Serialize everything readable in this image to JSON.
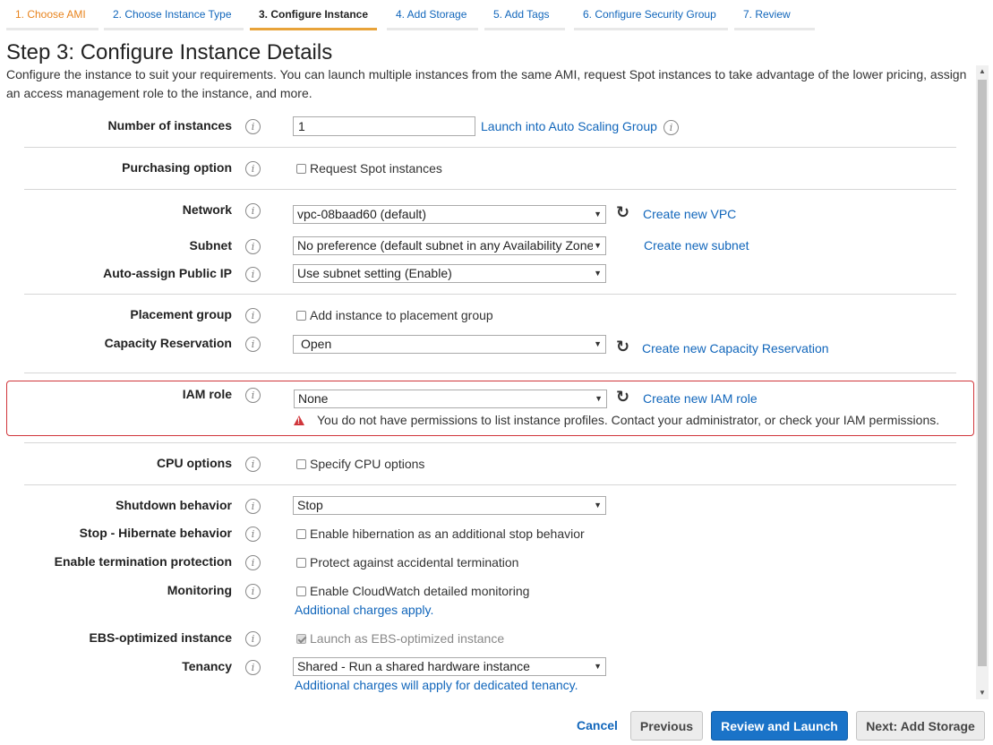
{
  "tabs": [
    {
      "label": "1. Choose AMI",
      "state": "done"
    },
    {
      "label": "2. Choose Instance Type",
      "state": "link"
    },
    {
      "label": "3. Configure Instance",
      "state": "active"
    },
    {
      "label": "4. Add Storage",
      "state": "link"
    },
    {
      "label": "5. Add Tags",
      "state": "link"
    },
    {
      "label": "6. Configure Security Group",
      "state": "link"
    },
    {
      "label": "7. Review",
      "state": "link"
    }
  ],
  "page": {
    "title": "Step 3: Configure Instance Details",
    "description": "Configure the instance to suit your requirements. You can launch multiple instances from the same AMI, request Spot instances to take advantage of the lower pricing, assign an access management role to the instance, and more."
  },
  "fields": {
    "instances": {
      "label": "Number of instances",
      "value": "1",
      "link": "Launch into Auto Scaling Group"
    },
    "purchasing": {
      "label": "Purchasing option",
      "checkbox": "Request Spot instances",
      "checked": false
    },
    "network": {
      "label": "Network",
      "value": "vpc-08baad60 (default)",
      "link": "Create new VPC"
    },
    "subnet": {
      "label": "Subnet",
      "value": "No preference (default subnet in any Availability Zone)",
      "link": "Create new subnet"
    },
    "public_ip": {
      "label": "Auto-assign Public IP",
      "value": "Use subnet setting (Enable)"
    },
    "placement": {
      "label": "Placement group",
      "checkbox": "Add instance to placement group",
      "checked": false
    },
    "capacity": {
      "label": "Capacity Reservation",
      "value": "Open",
      "link": "Create new Capacity Reservation"
    },
    "iam": {
      "label": "IAM role",
      "value": "None",
      "link": "Create new IAM role",
      "warning": "You do not have permissions to list instance profiles. Contact your administrator, or check your IAM permissions."
    },
    "cpu": {
      "label": "CPU options",
      "checkbox": "Specify CPU options",
      "checked": false
    },
    "shutdown": {
      "label": "Shutdown behavior",
      "value": "Stop"
    },
    "hibernate": {
      "label": "Stop - Hibernate behavior",
      "checkbox": "Enable hibernation as an additional stop behavior",
      "checked": false
    },
    "termination": {
      "label": "Enable termination protection",
      "checkbox": "Protect against accidental termination",
      "checked": false
    },
    "monitoring": {
      "label": "Monitoring",
      "checkbox": "Enable CloudWatch detailed monitoring",
      "checked": false,
      "note": "Additional charges apply."
    },
    "ebs": {
      "label": "EBS-optimized instance",
      "checkbox": "Launch as EBS-optimized instance",
      "checked": true,
      "disabled": true
    },
    "tenancy": {
      "label": "Tenancy",
      "value": "Shared - Run a shared hardware instance",
      "note": "Additional charges will apply for dedicated tenancy."
    }
  },
  "icons": {
    "info": "i",
    "refresh": "↻",
    "dropdown": "▼",
    "scroll_up": "▲",
    "scroll_down": "▼"
  },
  "footer": {
    "cancel": "Cancel",
    "previous": "Previous",
    "review": "Review and Launch",
    "next": "Next: Add Storage"
  },
  "colors": {
    "accent": "#1a73c8",
    "link": "#1166bb",
    "error": "#d0363b",
    "done_tab": "#e8841e"
  }
}
